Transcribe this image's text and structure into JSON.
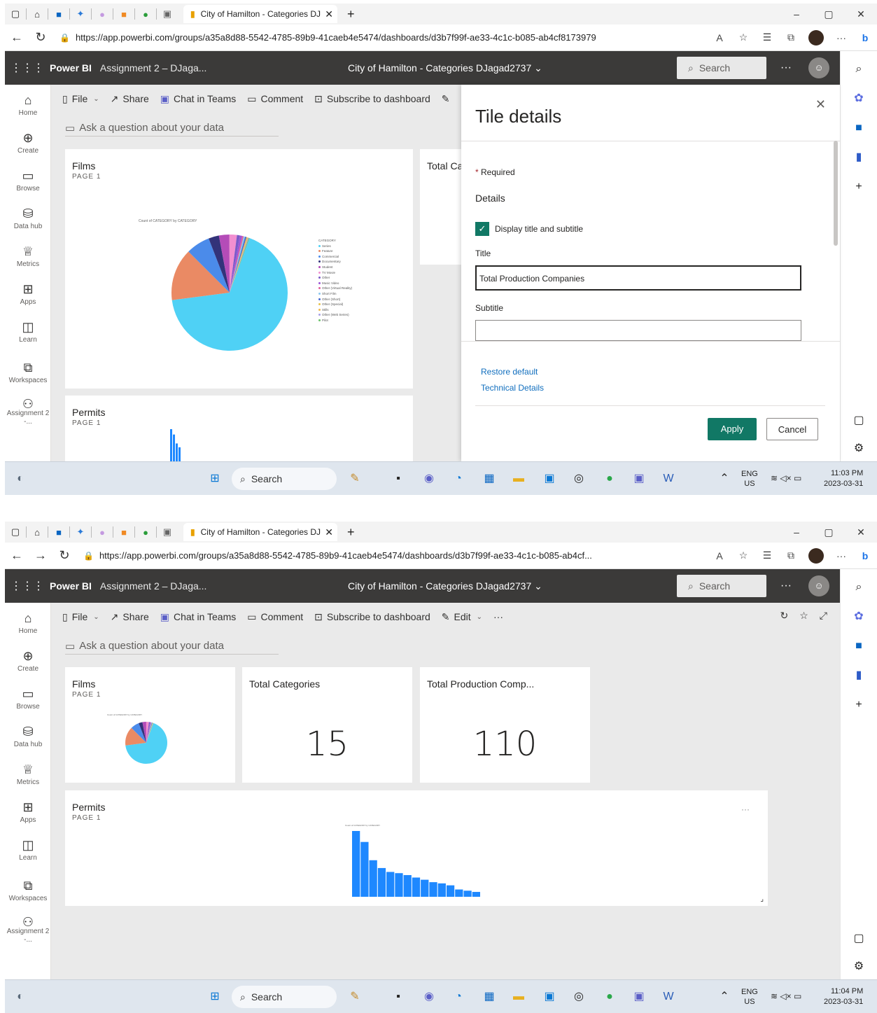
{
  "browser": {
    "tab_title": "City of Hamilton - Categories DJ",
    "url_a": "https://app.powerbi.com/groups/a35a8d88-5542-4785-89b9-41caeb4e5474/dashboards/d3b7f99f-ae33-4c1c-b085-ab4cf8173979",
    "url_b": "https://app.powerbi.com/groups/a35a8d88-5542-4785-89b9-41caeb4e5474/dashboards/d3b7f99f-ae33-4c1c-b085-ab4cf..."
  },
  "header": {
    "brand": "Power BI",
    "workspace": "Assignment 2 – DJaga...",
    "dashboard": "City of Hamilton - Categories DJagad2737",
    "search_placeholder": "Search"
  },
  "leftnav": [
    "Home",
    "Create",
    "Browse",
    "Data hub",
    "Metrics",
    "Apps",
    "Learn",
    "Workspaces",
    "Assignment 2 -..."
  ],
  "actions": {
    "file": "File",
    "share": "Share",
    "chat": "Chat in Teams",
    "comment": "Comment",
    "subscribe": "Subscribe to dashboard",
    "edit": "Edit"
  },
  "qa_placeholder": "Ask a question about your data",
  "tiles": {
    "films_title": "Films",
    "films_sub": "PAGE 1",
    "permits_title": "Permits",
    "permits_sub": "PAGE 1",
    "total_cat_title": "Total Categories",
    "total_cat_value": "15",
    "total_prod_title": "Total Production Comp...",
    "total_prod_value": "110",
    "total_ca_partial": "Total Ca"
  },
  "pane": {
    "title": "Tile details",
    "required": "Required",
    "details": "Details",
    "display_toggle": "Display title and subtitle",
    "title_label": "Title",
    "title_value": "Total Production Companies",
    "subtitle_label": "Subtitle",
    "subtitle_value": "",
    "restore": "Restore default",
    "technical": "Technical Details",
    "apply": "Apply",
    "cancel": "Cancel"
  },
  "taskbar": {
    "search": "Search",
    "lang": "ENG",
    "region": "US",
    "time_a": "11:03 PM",
    "time_b": "11:04 PM",
    "date": "2023-03-31"
  },
  "chart_data": [
    {
      "type": "pie",
      "title": "Count of CATEGORY by CATEGORY",
      "legend_title": "CATEGORY",
      "categories": [
        "Series",
        "Feature",
        "Commercial",
        "Documentary",
        "Student",
        "TV Movie",
        "Other",
        "Music Video",
        "Other (Virtual Reality)",
        "Short Film",
        "Other (Short)",
        "Other (Special)",
        "Stills",
        "Other (Web Series)",
        "Pilot"
      ],
      "values": [
        324,
        70,
        32,
        14,
        14,
        10,
        4,
        3,
        2,
        2,
        2,
        1,
        1,
        1,
        1
      ],
      "colors": [
        "#4fd1f5",
        "#ea8a64",
        "#4b8bea",
        "#33337a",
        "#b44cb8",
        "#f28fd0",
        "#7a5ac8",
        "#9b55d6",
        "#e0609c",
        "#8bc8f0",
        "#4a6ad0",
        "#e8c34c",
        "#f0b84c",
        "#a8a0e8",
        "#6cc46c"
      ],
      "legend": "right"
    },
    {
      "type": "bar",
      "title": "Count of CATEGORY by CATEGORY",
      "values": [
        270,
        225,
        150,
        118,
        102,
        97,
        89,
        79,
        70,
        60,
        55,
        47,
        30,
        25,
        20
      ],
      "color": "#1e88ff"
    }
  ]
}
